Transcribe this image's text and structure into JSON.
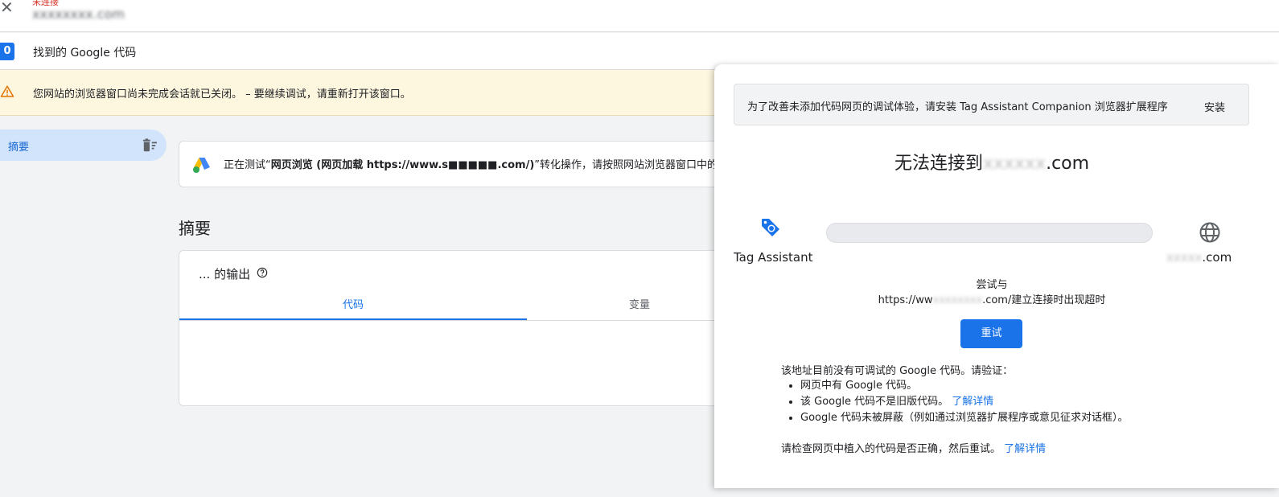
{
  "topbar": {
    "close_glyph": "✕",
    "status_text": "未连接",
    "domain_text": "xxxxxxxx.com"
  },
  "tagbar": {
    "count": "0",
    "found_label": "找到的 Google 代码"
  },
  "warning": {
    "icon": "warning-icon",
    "text": "您网站的浏览器窗口尚未完成会话就已关闭。 – 要继续调试，请重新打开该窗口。"
  },
  "sidebar": {
    "items": [
      {
        "label": "摘要",
        "icon": "clear-list-icon"
      }
    ]
  },
  "test_card": {
    "prefix": "正在测试“",
    "bold": "网页浏览 (网页加载 https://www.s■■■■■.com/)",
    "suffix": "”转化操作，请按照网站浏览器窗口中的说明操作"
  },
  "main": {
    "section_title": "摘要",
    "output_title": "... 的输出",
    "tabs": [
      {
        "label": "代码",
        "active": true
      },
      {
        "label": "变量",
        "active": false
      }
    ]
  },
  "panel": {
    "banner_text": "为了改善未添加代码网页的调试体验，请安装 Tag Assistant Companion 浏览器扩展程序",
    "install_label": "安装",
    "fail_prefix": "无法连接到",
    "fail_domain": "xxxxxx",
    "fail_suffix": ".com",
    "tag_assistant_label": "Tag Assistant",
    "site_blur": "xxxxx",
    "site_suffix": ".com",
    "try_line1": "尝试与",
    "try_prefix": "https://ww",
    "try_blur": "xxxxxxxx",
    "try_suffix": ".com/建立连接时出现超时",
    "retry_label": "重试",
    "checks_intro": "该地址目前没有可调试的 Google 代码。请验证：",
    "checks": [
      {
        "text": "网页中有 Google 代码。",
        "link": ""
      },
      {
        "text": "该 Google 代码不是旧版代码。",
        "link": "了解详情"
      },
      {
        "text": "Google 代码未被屏蔽（例如通过浏览器扩展程序或意见征求对话框）。",
        "link": ""
      }
    ],
    "recheck_text": "请检查网页中植入的代码是否正确，然后重试。",
    "recheck_link": "了解详情"
  },
  "colors": {
    "accent": "#1a73e8",
    "warning_bg": "#fef7e0",
    "selected_nav": "#d2e3fc"
  }
}
